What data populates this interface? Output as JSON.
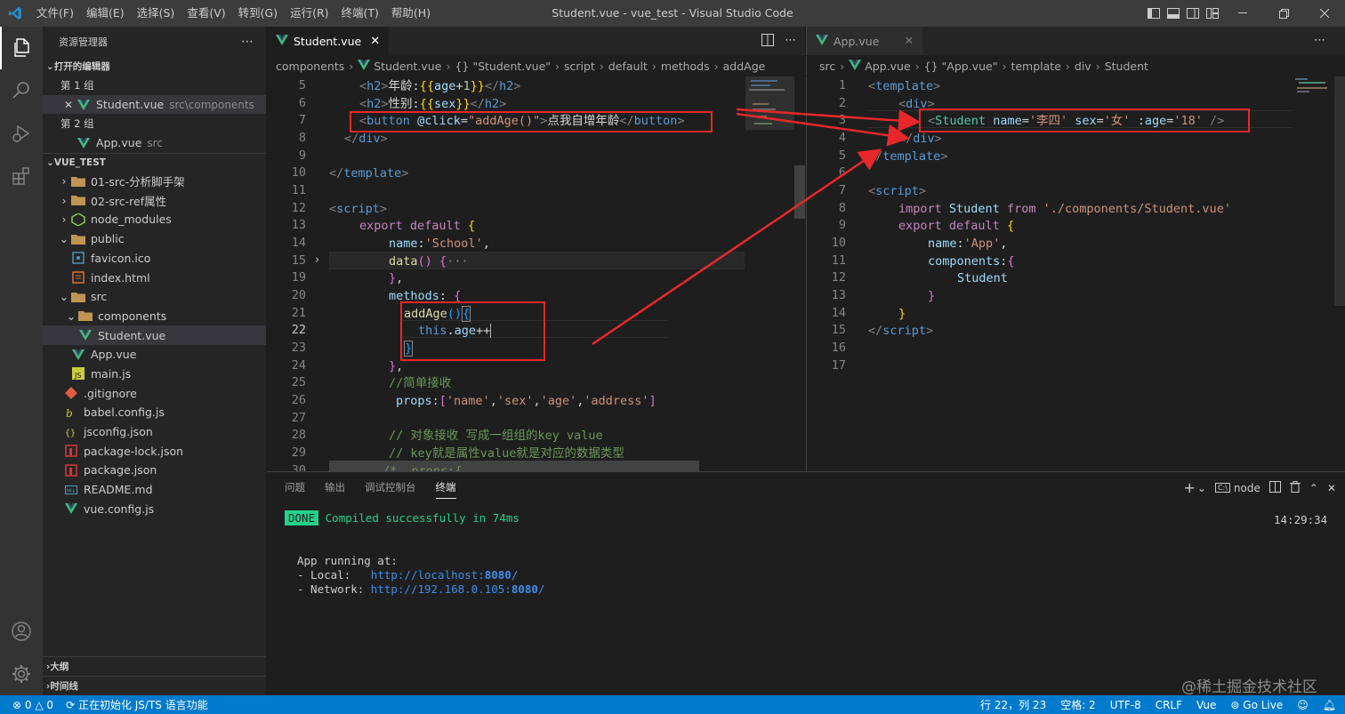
{
  "window": {
    "title": "Student.vue - vue_test - Visual Studio Code",
    "menu": [
      "文件(F)",
      "编辑(E)",
      "选择(S)",
      "查看(V)",
      "转到(G)",
      "运行(R)",
      "终端(T)",
      "帮助(H)"
    ]
  },
  "sidebar": {
    "title": "资源管理器",
    "open_editors_label": "打开的编辑器",
    "group1": "第 1 组",
    "group2": "第 2 组",
    "open_student": "Student.vue",
    "open_student_path": "src\\components",
    "open_app": "App.vue",
    "open_app_path": "src",
    "project": "VUE_TEST",
    "tree": [
      {
        "label": "01-src-分析脚手架",
        "kind": "folder",
        "depth": 0,
        "open": false
      },
      {
        "label": "02-src-ref属性",
        "kind": "folder",
        "depth": 0,
        "open": false
      },
      {
        "label": "node_modules",
        "kind": "folder-node",
        "depth": 0,
        "open": false
      },
      {
        "label": "public",
        "kind": "folder",
        "depth": 0,
        "open": true
      },
      {
        "label": "favicon.ico",
        "kind": "ico",
        "depth": 1
      },
      {
        "label": "index.html",
        "kind": "html",
        "depth": 1
      },
      {
        "label": "src",
        "kind": "folder",
        "depth": 0,
        "open": true
      },
      {
        "label": "components",
        "kind": "folder",
        "depth": 1,
        "open": true
      },
      {
        "label": "Student.vue",
        "kind": "vue",
        "depth": 2,
        "selected": true
      },
      {
        "label": "App.vue",
        "kind": "vue",
        "depth": 1
      },
      {
        "label": "main.js",
        "kind": "js",
        "depth": 1
      },
      {
        "label": ".gitignore",
        "kind": "git",
        "depth": 0
      },
      {
        "label": "babel.config.js",
        "kind": "babel",
        "depth": 0
      },
      {
        "label": "jsconfig.json",
        "kind": "json",
        "depth": 0
      },
      {
        "label": "package-lock.json",
        "kind": "npm",
        "depth": 0
      },
      {
        "label": "package.json",
        "kind": "npm",
        "depth": 0
      },
      {
        "label": "README.md",
        "kind": "md",
        "depth": 0
      },
      {
        "label": "vue.config.js",
        "kind": "vue",
        "depth": 0
      }
    ],
    "outline": "大纲",
    "timeline": "时间线"
  },
  "left_editor": {
    "tab": "Student.vue",
    "breadcrumb": [
      "components",
      "Student.vue",
      "{} \"Student.vue\"",
      "script",
      "default",
      "methods",
      "addAge"
    ]
  },
  "right_editor": {
    "tab": "App.vue",
    "breadcrumb": [
      "src",
      "App.vue",
      "{} \"App.vue\"",
      "template",
      "div",
      "Student"
    ]
  },
  "panel": {
    "tabs": [
      "问题",
      "输出",
      "调试控制台",
      "终端"
    ],
    "active_tab": "终端",
    "shell": "node",
    "done_badge": "DONE",
    "compiled": "Compiled successfully in 74ms",
    "time": "14:29:34",
    "running": "App running at:",
    "local_label": "- Local:   ",
    "local_url": "http://localhost:",
    "local_port": "8080",
    "network_label": "- Network: ",
    "network_url": "http://192.168.0.105:",
    "network_port": "8080"
  },
  "status": {
    "errors": "0",
    "warnings": "0",
    "init": "正在初始化 JS/TS 语言功能",
    "position": "行 22，列 23",
    "spaces": "空格: 2",
    "encoding": "UTF-8",
    "eol": "CRLF",
    "lang": "Vue",
    "golive": "Go Live",
    "watermark": "@稀土掘金技术社区"
  }
}
